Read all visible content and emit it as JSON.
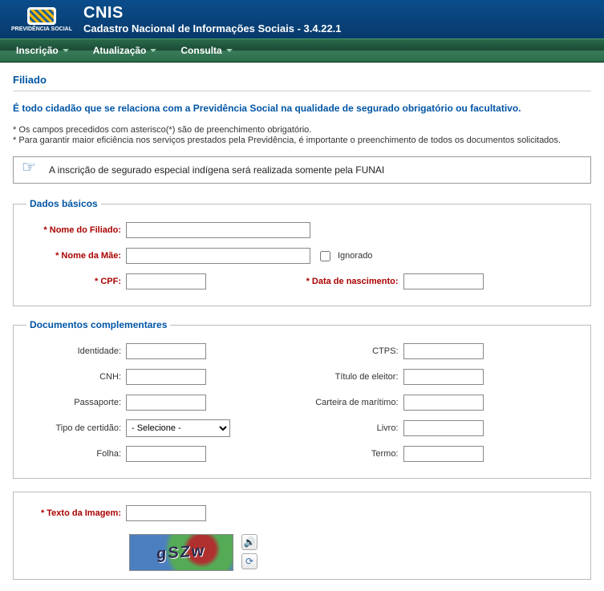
{
  "header": {
    "logo_text": "PREVIDÊNCIA SOCIAL",
    "title": "CNIS",
    "subtitle": "Cadastro Nacional de Informações Sociais - 3.4.22.1"
  },
  "menu": {
    "items": [
      "Inscrição",
      "Atualização",
      "Consulta"
    ]
  },
  "page": {
    "heading": "Filiado",
    "intro": "É todo cidadão que se relaciona com a Previdência Social na qualidade de segurado obrigatório ou facultativo.",
    "note1": "* Os campos precedidos com asterisco(*) são de preenchimento obrigatório.",
    "note2": "* Para garantir maior eficiência nos serviços prestados pela Previdência, é importante o preenchimento de todos os documentos solicitados.",
    "alert": "A inscrição de segurado especial indígena será realizada somente pela FUNAI"
  },
  "basics": {
    "legend": "Dados básicos",
    "nome_filiado_lbl": "Nome do Filiado:",
    "nome_mae_lbl": "Nome da Mãe:",
    "ignorado_lbl": "Ignorado",
    "cpf_lbl": "CPF:",
    "data_lbl": "Data de nascimento:"
  },
  "docs": {
    "legend": "Documentos complementares",
    "identidade_lbl": "Identidade:",
    "ctps_lbl": "CTPS:",
    "cnh_lbl": "CNH:",
    "titulo_lbl": "Título de eleitor:",
    "passaporte_lbl": "Passaporte:",
    "carteira_lbl": "Carteira de marítimo:",
    "tipo_certidao_lbl": "Tipo de certidão:",
    "tipo_certidao_selected": "- Selecione -",
    "livro_lbl": "Livro:",
    "folha_lbl": "Folha:",
    "termo_lbl": "Termo:"
  },
  "captcha": {
    "label": "Texto da Imagem:",
    "text": "gSZw"
  }
}
